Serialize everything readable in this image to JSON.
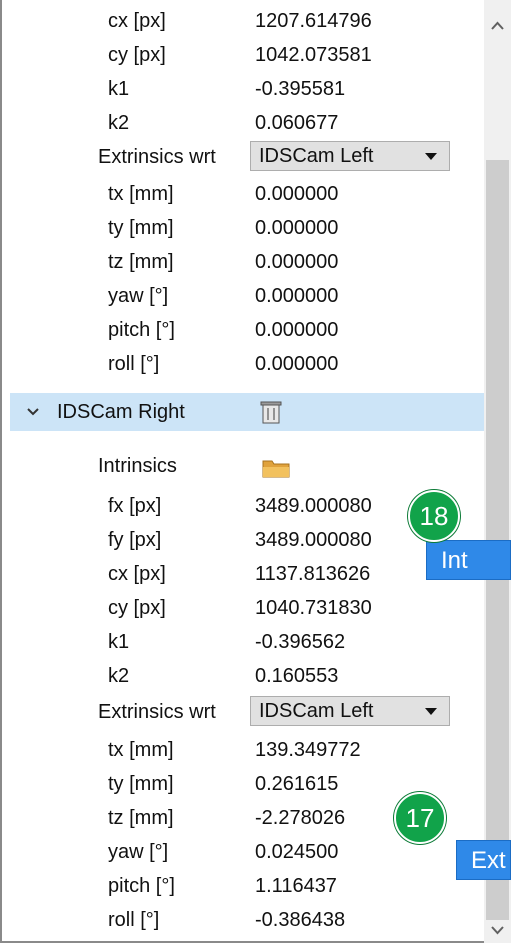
{
  "rows_top": [
    {
      "label": "cx [px]",
      "value": "1207.614796"
    },
    {
      "label": "cy [px]",
      "value": "1042.073581"
    },
    {
      "label": "k1",
      "value": "-0.395581"
    },
    {
      "label": "k2",
      "value": "0.060677"
    }
  ],
  "extrinsics_left": {
    "label": "Extrinsics wrt",
    "value": "IDSCam Left"
  },
  "rows_left_extr": [
    {
      "label": "tx [mm]",
      "value": "0.000000"
    },
    {
      "label": "ty [mm]",
      "value": "0.000000"
    },
    {
      "label": "tz [mm]",
      "value": "0.000000"
    },
    {
      "label": "yaw [°]",
      "value": "0.000000"
    },
    {
      "label": "pitch [°]",
      "value": "0.000000"
    },
    {
      "label": "roll [°]",
      "value": "0.000000"
    }
  ],
  "camera_right": {
    "label": "IDSCam Right",
    "icon": "trash-icon"
  },
  "intrinsics": {
    "label": "Intrinsics",
    "icon": "folder-icon"
  },
  "rows_right_intr": [
    {
      "label": "fx [px]",
      "value": "3489.000080"
    },
    {
      "label": "fy [px]",
      "value": "3489.000080"
    },
    {
      "label": "cx [px]",
      "value": "1137.813626"
    },
    {
      "label": "cy [px]",
      "value": "1040.731830"
    },
    {
      "label": "k1",
      "value": "-0.396562"
    },
    {
      "label": "k2",
      "value": "0.160553"
    }
  ],
  "extrinsics_right": {
    "label": "Extrinsics wrt",
    "value": "IDSCam Left"
  },
  "rows_right_extr": [
    {
      "label": "tx [mm]",
      "value": "139.349772"
    },
    {
      "label": "ty [mm]",
      "value": "0.261615"
    },
    {
      "label": "tz [mm]",
      "value": "-2.278026"
    },
    {
      "label": "yaw [°]",
      "value": "0.024500"
    },
    {
      "label": "pitch [°]",
      "value": "1.116437"
    },
    {
      "label": "roll [°]",
      "value": "-0.386438"
    }
  ],
  "callouts": [
    {
      "number": "18",
      "text": "Int"
    },
    {
      "number": "17",
      "text": "Ext"
    }
  ],
  "colors": {
    "selected_row": "#cce4f7",
    "badge": "#11a34a",
    "callout": "#2f89e8"
  }
}
